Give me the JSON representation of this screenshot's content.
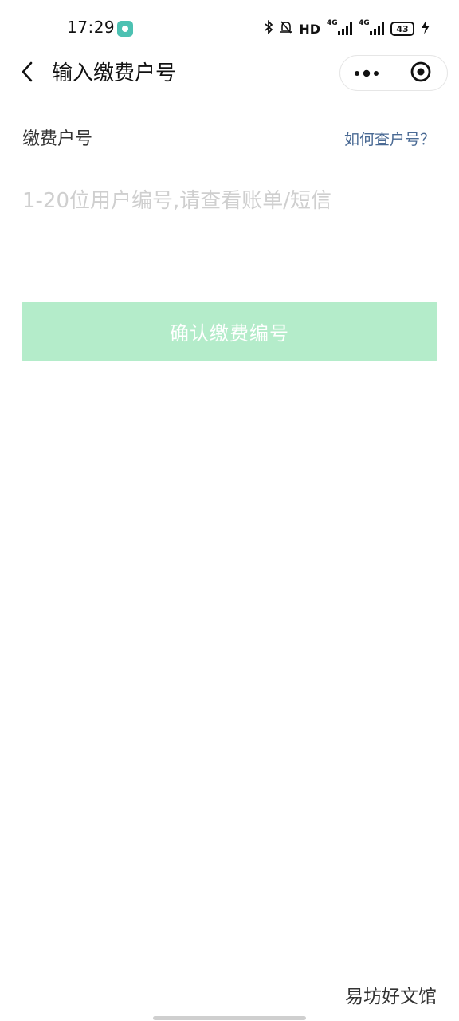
{
  "status_bar": {
    "time": "17:29",
    "hd_label": "HD",
    "net_type_1": "4G",
    "net_type_2": "4G",
    "battery_level": "43"
  },
  "nav": {
    "title": "输入缴费户号"
  },
  "form": {
    "label": "缴费户号",
    "help_link": "如何查户号？",
    "input_placeholder": "1-20位用户编号,请查看账单/短信",
    "input_value": ""
  },
  "actions": {
    "confirm_label": "确认缴费编号"
  },
  "watermark": "易坊好文馆",
  "colors": {
    "accent_disabled": "#b4ecca",
    "link": "#4a6a94"
  }
}
